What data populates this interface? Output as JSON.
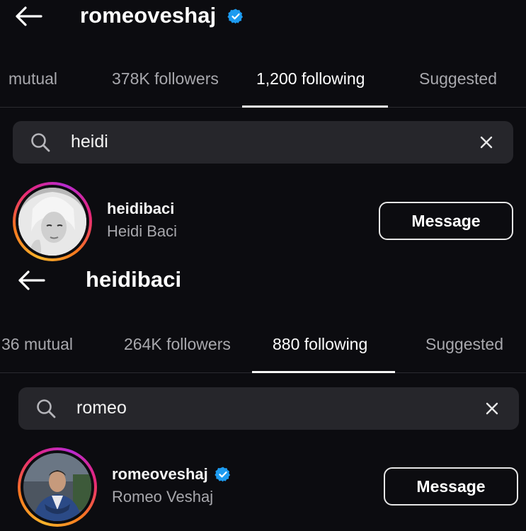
{
  "panel1": {
    "header": {
      "title": "romeoveshaj",
      "verified": true
    },
    "tabs": [
      {
        "label": "mutual",
        "active": false
      },
      {
        "label": "378K followers",
        "active": false
      },
      {
        "label": "1,200 following",
        "active": true
      },
      {
        "label": "Suggested",
        "active": false
      }
    ],
    "search": {
      "value": "heidi"
    },
    "result": {
      "username": "heidibaci",
      "full_name": "Heidi Baci",
      "verified": false,
      "button_label": "Message"
    }
  },
  "panel2": {
    "header": {
      "title": "heidibaci",
      "verified": false
    },
    "tabs": [
      {
        "label": "36 mutual",
        "active": false
      },
      {
        "label": "264K followers",
        "active": false
      },
      {
        "label": "880 following",
        "active": true
      },
      {
        "label": "Suggested",
        "active": false
      }
    ],
    "search": {
      "value": "romeo"
    },
    "result": {
      "username": "romeoveshaj",
      "full_name": "Romeo Veshaj",
      "verified": true,
      "button_label": "Message"
    }
  },
  "colors": {
    "background": "#0c0c10",
    "search_bg": "#26262b",
    "verified_blue": "#1d9bf0",
    "muted_text": "#a8a8ad"
  },
  "icons": [
    "back-arrow-icon",
    "verified-badge-icon",
    "search-icon",
    "close-icon"
  ]
}
